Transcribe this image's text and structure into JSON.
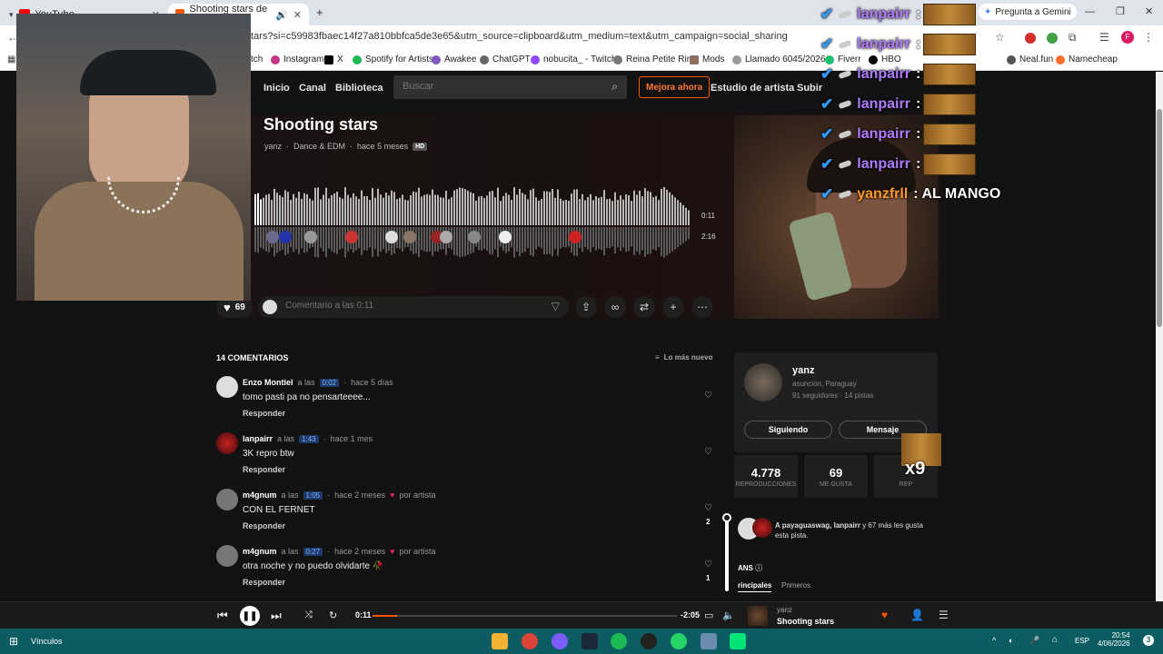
{
  "browser": {
    "tabs": [
      {
        "label": "YouTube",
        "color": "#ff0000"
      },
      {
        "label": "Shooting stars de yanz",
        "color": "#ff5500"
      }
    ],
    "new_tab": "+",
    "url": "tars?si=c59983fbaec14f27a810bbfca5de3e65&utm_source=clipboard&utm_medium=text&utm_campaign=social_sharing",
    "gemini_label": "Pregunta a Gemini",
    "bookmarks": [
      "tch",
      "Instagram",
      "X",
      "Spotify for Artists",
      "Awakee",
      "ChatGPT",
      "nobucita_ - Twitch",
      "Reina Petite Ring",
      "Mods",
      "Llamado 6045/2026...",
      "Fiverr",
      "HBO",
      "Neal.fun",
      "Namecheap"
    ]
  },
  "site": {
    "nav": {
      "home": "Inicio",
      "feed": "Canal",
      "library": "Biblioteca",
      "search_placeholder": "Buscar",
      "upgrade": "Mejora ahora",
      "studio": "Estudio de artista",
      "upload": "Subir"
    },
    "track": {
      "title": "Shooting stars",
      "artist": "yanz",
      "genre": "Dance & EDM",
      "age": "hace 5 meses",
      "quality": "HD",
      "current_time": "0:11",
      "duration": "2:16"
    },
    "actions": {
      "likes": "69",
      "comment_placeholder": "Comentario a las 0:11"
    },
    "comments": {
      "header": "14 COMENTARIOS",
      "sort": "Lo más nuevo",
      "items": [
        {
          "user": "Enzo Montiel",
          "at": "a las",
          "time": "0:02",
          "age": "hace 5 días",
          "text": "tomo pasti pa no pensarteeee...",
          "reply": "Responder",
          "likes": "",
          "artist": ""
        },
        {
          "user": "lanpairr",
          "at": "a las",
          "time": "1:43",
          "age": "hace 1 mes",
          "text": "3K repro btw",
          "reply": "Responder",
          "likes": "",
          "artist": ""
        },
        {
          "user": "m4gnum",
          "at": "a las",
          "time": "1:05",
          "age": "hace 2 meses",
          "text": "CON EL FERNET",
          "reply": "Responder",
          "likes": "2",
          "artist": "por artista"
        },
        {
          "user": "m4gnum",
          "at": "a las",
          "time": "0:27",
          "age": "hace 2 meses",
          "text": "otra noche y no puedo olvidarte 🥀",
          "reply": "Responder",
          "likes": "1",
          "artist": "por artista"
        }
      ]
    },
    "artist": {
      "name": "yanz",
      "location": "asuncion, Paraguay",
      "stats": "91 seguidores · 14 pistas",
      "follow": "Siguiendo",
      "message": "Mensaje"
    },
    "stats": [
      {
        "value": "4.778",
        "label": "REPRODUCCIONES"
      },
      {
        "value": "69",
        "label": "ME GUSTA"
      },
      {
        "value": "",
        "label": "REP"
      }
    ],
    "likers": {
      "bold": "A payaguaswag, lanpairr",
      "rest": " y 67 más les gusta esta pista."
    },
    "fans": {
      "header": "ANS",
      "tab1": "rincipales",
      "tab2": "Primeros"
    }
  },
  "player": {
    "elapsed": "0:11",
    "remaining": "-2:05",
    "progress": 0.08,
    "artist": "yanz",
    "title": "Shooting stars"
  },
  "taskbar": {
    "links_label": "Vínculos",
    "lang": "ESP",
    "time": "20:54",
    "date": "4/06/2026",
    "notif": "3"
  },
  "overlay": {
    "chat": [
      {
        "user": "lanpairr",
        "text": ":",
        "color": "#b07cff"
      },
      {
        "user": "lanpairr",
        "text": ":",
        "color": "#b07cff"
      },
      {
        "user": "lanpairr",
        "text": ":",
        "color": "#b07cff"
      },
      {
        "user": "lanpairr",
        "text": ":",
        "color": "#b07cff"
      },
      {
        "user": "lanpairr",
        "text": ":",
        "color": "#b07cff"
      },
      {
        "user": "lanpairr",
        "text": ":",
        "color": "#b07cff"
      },
      {
        "user": "yanzfrll",
        "text": ": AL MANGO",
        "color": "#ff9a2a"
      }
    ],
    "combo": "x9"
  },
  "colors": {
    "accent": "#ff5500",
    "bg": "#121212",
    "card": "#1f1f1f",
    "taskbar": "#0c5d62"
  }
}
